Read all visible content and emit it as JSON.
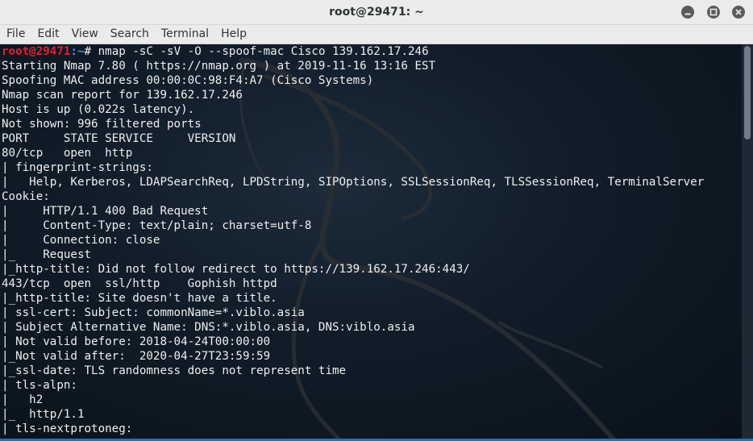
{
  "window": {
    "title": "root@29471: ~"
  },
  "window_controls": [
    {
      "name": "minimize-icon"
    },
    {
      "name": "maximize-icon"
    },
    {
      "name": "close-icon"
    }
  ],
  "menu": [
    "File",
    "Edit",
    "View",
    "Search",
    "Terminal",
    "Help"
  ],
  "prompt": {
    "user": "root@29471",
    "sep": ":",
    "path": "~",
    "symbol": "# ",
    "command": "nmap -sC -sV -O --spoof-mac Cisco 139.162.17.246"
  },
  "lines": [
    "Starting Nmap 7.80 ( https://nmap.org ) at 2019-11-16 13:16 EST",
    "Spoofing MAC address 00:00:0C:98:F4:A7 (Cisco Systems)",
    "Nmap scan report for 139.162.17.246",
    "Host is up (0.022s latency).",
    "Not shown: 996 filtered ports",
    "PORT     STATE SERVICE     VERSION",
    "80/tcp   open  http",
    "| fingerprint-strings:",
    "|   Help, Kerberos, LDAPSearchReq, LPDString, SIPOptions, SSLSessionReq, TLSSessionReq, TerminalServer",
    "Cookie:",
    "|     HTTP/1.1 400 Bad Request",
    "|     Content-Type: text/plain; charset=utf-8",
    "|     Connection: close",
    "|_    Request",
    "|_http-title: Did not follow redirect to https://139.162.17.246:443/",
    "443/tcp  open  ssl/http    Gophish httpd",
    "|_http-title: Site doesn't have a title.",
    "| ssl-cert: Subject: commonName=*.viblo.asia",
    "| Subject Alternative Name: DNS:*.viblo.asia, DNS:viblo.asia",
    "| Not valid before: 2018-04-24T00:00:00",
    "|_Not valid after:  2020-04-27T23:59:59",
    "|_ssl-date: TLS randomness does not represent time",
    "| tls-alpn:",
    "|   h2",
    "|_  http/1.1",
    "| tls-nextprotoneg:"
  ],
  "colors": {
    "prompt_user": "#e4202c",
    "prompt_path": "#5f8dd3",
    "text": "#eeeeee",
    "background": "#0c1620"
  }
}
